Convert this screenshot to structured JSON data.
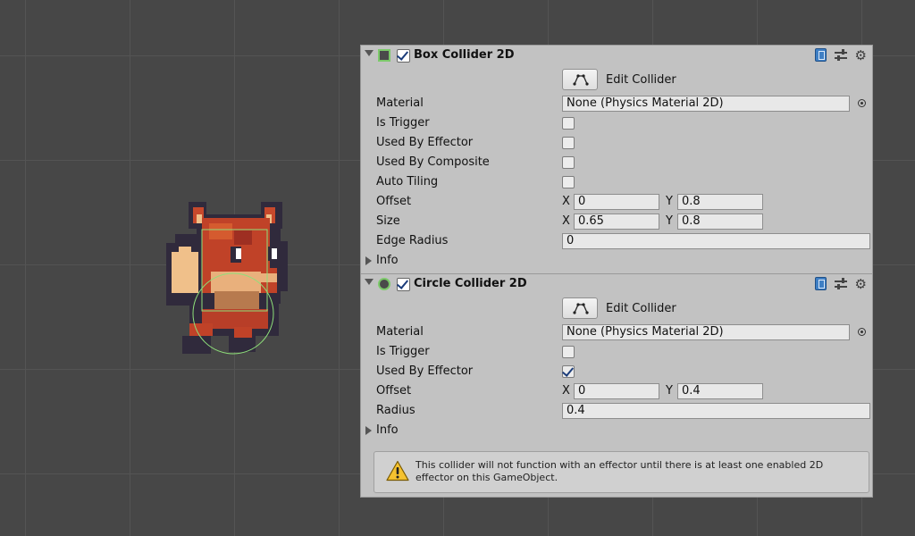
{
  "components": [
    {
      "title": "Box Collider 2D",
      "icon": "box-collider-icon",
      "enabled": true,
      "edit_collider_label": "Edit Collider",
      "material": {
        "label": "Material",
        "value": "None (Physics Material 2D)"
      },
      "is_trigger": {
        "label": "Is Trigger",
        "checked": false
      },
      "used_by_effector": {
        "label": "Used By Effector",
        "checked": false
      },
      "used_by_composite": {
        "label": "Used By Composite",
        "checked": false
      },
      "auto_tiling": {
        "label": "Auto Tiling",
        "checked": false
      },
      "offset": {
        "label": "Offset",
        "x_label": "X",
        "x": "0",
        "y_label": "Y",
        "y": "0.8"
      },
      "size": {
        "label": "Size",
        "x_label": "X",
        "x": "0.65",
        "y_label": "Y",
        "y": "0.8"
      },
      "edge_radius": {
        "label": "Edge Radius",
        "value": "0"
      },
      "info_label": "Info"
    },
    {
      "title": "Circle Collider 2D",
      "icon": "circle-collider-icon",
      "enabled": true,
      "edit_collider_label": "Edit Collider",
      "material": {
        "label": "Material",
        "value": "None (Physics Material 2D)"
      },
      "is_trigger": {
        "label": "Is Trigger",
        "checked": false
      },
      "used_by_effector": {
        "label": "Used By Effector",
        "checked": true
      },
      "offset": {
        "label": "Offset",
        "x_label": "X",
        "x": "0",
        "y_label": "Y",
        "y": "0.4"
      },
      "radius": {
        "label": "Radius",
        "value": "0.4"
      },
      "info_label": "Info",
      "warning": "This collider will not function with an effector until there is at least one enabled 2D effector on this GameObject."
    }
  ],
  "colors": {
    "scene_background": "#474747",
    "grid_line": "#545454",
    "inspector_background": "#c2c2c2",
    "collider_gizmo": "#8ee07a",
    "fox_orange": "#b8402a",
    "fox_light": "#f0c08a",
    "fox_outline": "#302a3c"
  }
}
